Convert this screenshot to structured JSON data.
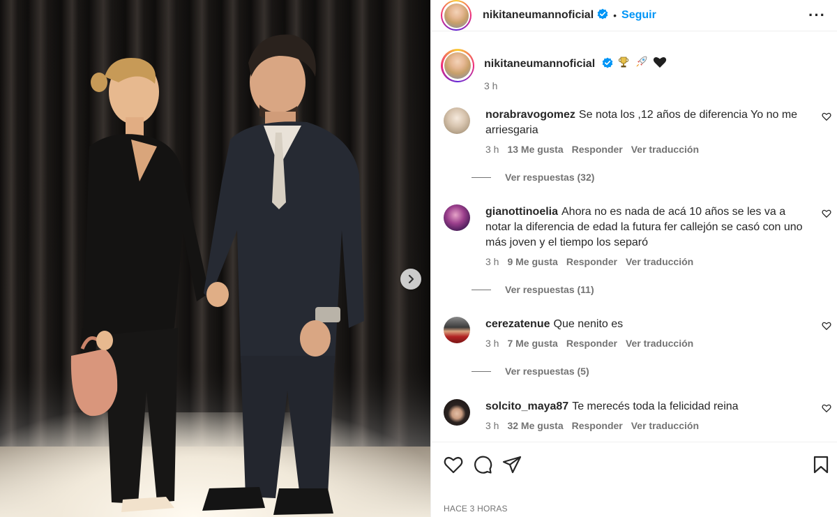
{
  "post": {
    "username": "nikitaneumannoficial",
    "follow_label": "Seguir",
    "more_label": "···",
    "caption_time": "3 h",
    "posted_label": "HACE 3 HORAS",
    "photo_alt": "post-photo"
  },
  "icons": {
    "verified": "verified-badge-icon",
    "trophy": "trophy-emoji",
    "rocket": "rocket-emoji",
    "heart_black": "black-heart-emoji",
    "like": "heart-icon",
    "comment": "comment-icon",
    "share": "share-icon",
    "save": "bookmark-icon",
    "next": "chevron-right-icon"
  },
  "colors": {
    "accent": "#0095f6",
    "verified": "#0095f6",
    "muted": "#737373",
    "text": "#262626"
  },
  "comments": [
    {
      "user": "norabravogomez",
      "text": "Se nota los ,12 años de diferencia Yo no me arriesgaria",
      "time": "3 h",
      "likes": "13 Me gusta",
      "reply": "Responder",
      "translate": "Ver traducción",
      "replies": "Ver respuestas (32)"
    },
    {
      "user": "gianottinoelia",
      "text": "Ahora no es nada de acá 10 años se les va a notar la diferencia de edad la futura fer callejón se casó con uno más joven y el tiempo los separó",
      "time": "3 h",
      "likes": "9 Me gusta",
      "reply": "Responder",
      "translate": "Ver traducción",
      "replies": "Ver respuestas (11)"
    },
    {
      "user": "cerezatenue",
      "text": "Que nenito es",
      "time": "3 h",
      "likes": "7 Me gusta",
      "reply": "Responder",
      "translate": "Ver traducción",
      "replies": "Ver respuestas (5)"
    },
    {
      "user": "solcito_maya87",
      "text": "Te merecés toda la felicidad reina",
      "time": "3 h",
      "likes": "32 Me gusta",
      "reply": "Responder",
      "translate": "Ver traducción"
    }
  ]
}
